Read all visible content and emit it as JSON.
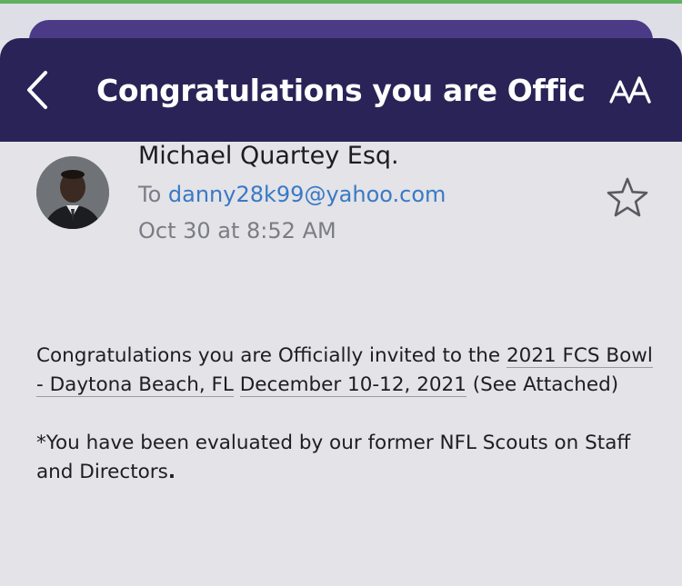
{
  "header": {
    "title": "Congratulations you are Offici...",
    "back_icon": "chevron-left-icon",
    "text_size_icon": "text-size-icon"
  },
  "email": {
    "sender": "Michael Quartey Esq.",
    "to_label": "To",
    "to_address": "danny28k99@yahoo.com",
    "date": "Oct 30 at 8:52 AM",
    "star_icon": "star-outline-icon"
  },
  "body": {
    "p1_part1": "Congratulations you are Officially invited to the ",
    "p1_link1": "2021 FCS Bowl - Daytona Beach, FL",
    "p1_space": " ",
    "p1_link2": "December 10-12, 2021",
    "p1_part2": " (See Attached)",
    "p2_text": "*You have been evaluated by our former NFL Scouts on Staff and Directors",
    "p2_end": "."
  },
  "colors": {
    "header_bg": "#2a2357",
    "header_back_card": "#4b3a86",
    "page_bg": "#e3e3e8",
    "link": "#3a79c4",
    "top_line": "#5fb15e"
  }
}
